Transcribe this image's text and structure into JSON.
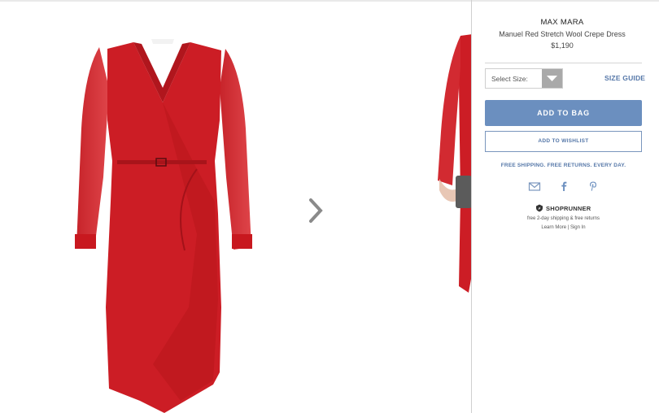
{
  "product": {
    "brand": "MAX MARA",
    "name": "Manuel Red Stretch Wool Crepe Dress",
    "price": "$1,190"
  },
  "size": {
    "placeholder": "Select Size:",
    "guide_label": "SIZE GUIDE"
  },
  "actions": {
    "add_to_bag": "ADD TO BAG",
    "add_to_wishlist": "ADD TO WISHLIST"
  },
  "shipping_message": "FREE SHIPPING. FREE RETURNS. EVERY DAY.",
  "share_icons": [
    "email-icon",
    "facebook-icon",
    "pinterest-icon"
  ],
  "shoprunner": {
    "name": "SHOPRUNNER",
    "tagline": "free 2-day shipping & free returns",
    "learn_more": "Learn More",
    "separator": " | ",
    "sign_in": "Sign In"
  },
  "colors": {
    "accent": "#6b8fbf",
    "link": "#5577a8",
    "dress": "#cc1d25"
  }
}
